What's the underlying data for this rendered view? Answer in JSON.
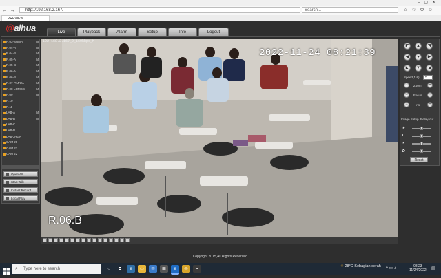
{
  "browser": {
    "url": "http://192.168.2.167/",
    "search_placeholder": "Search...",
    "tab_label": "PREVIEW"
  },
  "app": {
    "logo": "alhua",
    "nav_tabs": [
      "Live",
      "Playback",
      "Alarm",
      "Setup",
      "Info",
      "Logout"
    ],
    "active_tab": "Live",
    "devices": [
      {
        "label": "R.03-SUMAI",
        "m": "M"
      },
      {
        "label": "R.04-A",
        "m": "M"
      },
      {
        "label": "R.04-B",
        "m": "M"
      },
      {
        "label": "R.05-A",
        "m": "M"
      },
      {
        "label": "R.05-B",
        "m": "M"
      },
      {
        "label": "R.06-A",
        "m": "M"
      },
      {
        "label": "R.06-B",
        "m": "M"
      },
      {
        "label": "R.07-PAPUA",
        "m": "M"
      },
      {
        "label": "R.08-LOMBC",
        "m": "M"
      },
      {
        "label": "R.09",
        "m": "M"
      },
      {
        "label": "R.10",
        "m": ""
      },
      {
        "label": "R.11",
        "m": ""
      },
      {
        "label": "LAB-A",
        "m": "M"
      },
      {
        "label": "LAB-B",
        "m": "M"
      },
      {
        "label": "LAB-C",
        "m": ""
      },
      {
        "label": "LAB-D",
        "m": ""
      },
      {
        "label": "LAB-JRGN",
        "m": ""
      },
      {
        "label": "CAM 20",
        "m": ""
      },
      {
        "label": "CAM 21",
        "m": ""
      },
      {
        "label": "CAM 22",
        "m": ""
      }
    ],
    "left_buttons": [
      "Open All",
      "Start Talk",
      "Instant Record",
      "Local Play"
    ],
    "video": {
      "header": "192.168.2.167_9_160kbps_M",
      "timestamp": "2022-11-24  08:21:39",
      "room_label": "R.06.B"
    },
    "ptz": {
      "speed_label": "Speed(1-8):",
      "speed_value": "5",
      "zoom_label": "Zoom",
      "focus_label": "Focus",
      "iris_label": "Iris"
    },
    "image_setup": {
      "tab1": "Image Setup",
      "tab2": "Relay-out",
      "reset_label": "Reset"
    },
    "copyright": "Copyright 2015,All Rights Reserved."
  },
  "taskbar": {
    "search_placeholder": "Type here to search",
    "weather_temp": "28°C",
    "weather_text": "Sebagian cerah",
    "time": "08:23",
    "date": "11/24/2022"
  }
}
